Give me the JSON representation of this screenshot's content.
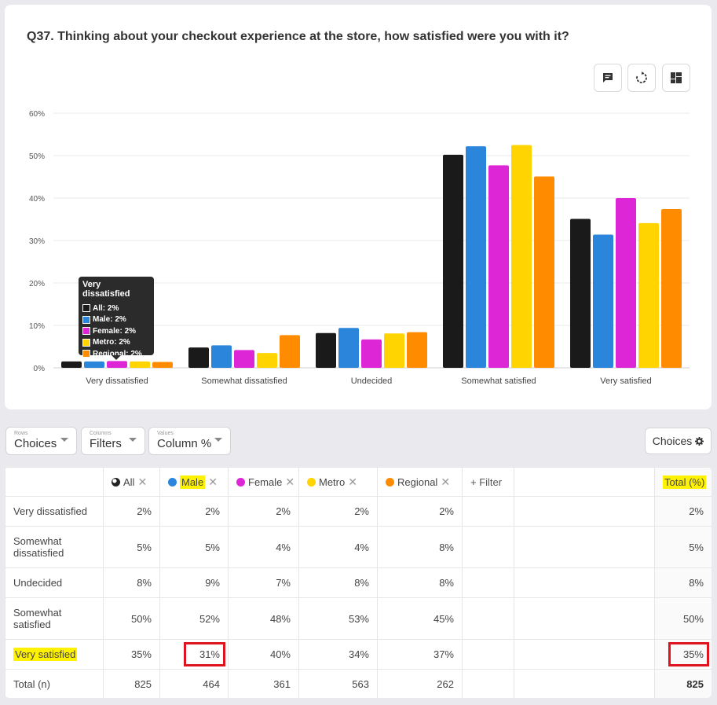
{
  "question": "Q37. Thinking about your checkout experience at the store, how satisfied were you with it?",
  "toolbar": {
    "comment_icon": "comment-icon",
    "refresh_icon": "refresh-icon",
    "layout_icon": "dashboard-layout-icon"
  },
  "chart_data": {
    "type": "bar",
    "categories": [
      "Very dissatisfied",
      "Somewhat dissatisfied",
      "Undecided",
      "Somewhat satisfied",
      "Very satisfied"
    ],
    "series": [
      {
        "name": "All",
        "color": "#1a1a1a",
        "values": [
          1.5,
          4.8,
          8.2,
          50.2,
          35.1
        ]
      },
      {
        "name": "Male",
        "color": "#2b86db",
        "values": [
          1.5,
          5.3,
          9.4,
          52.2,
          31.4
        ]
      },
      {
        "name": "Female",
        "color": "#dd26d5",
        "values": [
          1.6,
          4.2,
          6.7,
          47.7,
          40.0
        ]
      },
      {
        "name": "Metro",
        "color": "#ffd400",
        "values": [
          1.5,
          3.5,
          8.1,
          52.5,
          34.1
        ]
      },
      {
        "name": "Regional",
        "color": "#ff8c00",
        "values": [
          1.4,
          7.7,
          8.4,
          45.1,
          37.4
        ]
      }
    ],
    "ylim": [
      0,
      60
    ],
    "yticks": [
      "0%",
      "10%",
      "20%",
      "30%",
      "40%",
      "50%",
      "60%"
    ],
    "grid": true
  },
  "tooltip": {
    "title": "Very dissatisfied",
    "rows": [
      "All: 2%",
      "Male: 2%",
      "Female: 2%",
      "Metro: 2%",
      "Regional: 2%"
    ]
  },
  "controls": {
    "rows_small": "Rows",
    "rows_value": "Choices",
    "cols_small": "Columns",
    "cols_value": "Filters",
    "values_small": "Values",
    "values_value": "Column %",
    "choices_button": "Choices"
  },
  "table": {
    "headers": {
      "all": "All",
      "male": "Male",
      "female": "Female",
      "metro": "Metro",
      "regional": "Regional",
      "filter": "+ Filter",
      "total": "Total (%)"
    },
    "rows": [
      {
        "label": "Very dissatisfied",
        "all": "2%",
        "male": "2%",
        "female": "2%",
        "metro": "2%",
        "regional": "2%",
        "total": "2%"
      },
      {
        "label": "Somewhat dissatisfied",
        "all": "5%",
        "male": "5%",
        "female": "4%",
        "metro": "4%",
        "regional": "8%",
        "total": "5%"
      },
      {
        "label": "Undecided",
        "all": "8%",
        "male": "9%",
        "female": "7%",
        "metro": "8%",
        "regional": "8%",
        "total": "8%"
      },
      {
        "label": "Somewhat satisfied",
        "all": "50%",
        "male": "52%",
        "female": "48%",
        "metro": "53%",
        "regional": "45%",
        "total": "50%"
      },
      {
        "label": "Very satisfied",
        "all": "35%",
        "male": "31%",
        "female": "40%",
        "metro": "34%",
        "regional": "37%",
        "total": "35%"
      },
      {
        "label": "Total (n)",
        "all": "825",
        "male": "464",
        "female": "361",
        "metro": "563",
        "regional": "262",
        "total": "825"
      }
    ]
  }
}
